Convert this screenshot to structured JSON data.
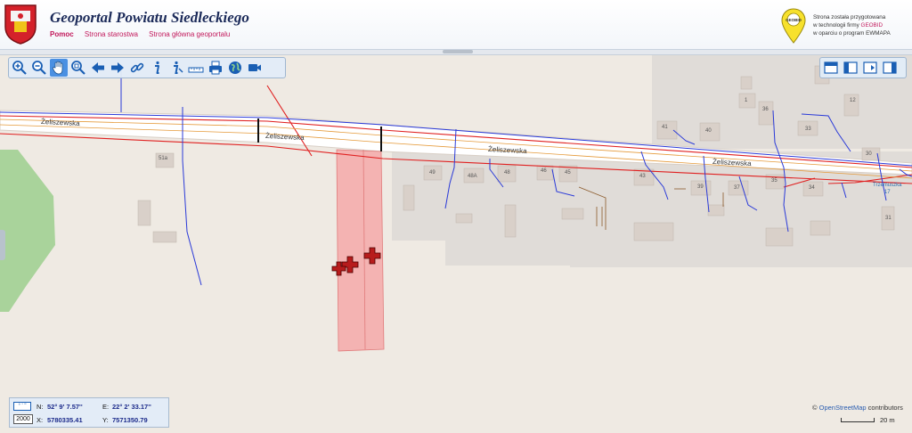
{
  "header": {
    "title": "Geoportal Powiatu Siedleckiego",
    "nav": [
      "Pomoc",
      "Strona starostwa",
      "Strona główna geoportalu"
    ],
    "logo_text": "GEOBID",
    "credit_line1": "Strona została przygotowana",
    "credit_line2_prefix": "w technologii firmy",
    "credit_line2_brand": "GEOBID",
    "credit_line3": "w oparciu o program EWMAPA"
  },
  "toolbar": {
    "tools": [
      {
        "name": "zoom-in-icon",
        "active": false
      },
      {
        "name": "zoom-out-icon",
        "active": false
      },
      {
        "name": "pan-hand-icon",
        "active": true
      },
      {
        "name": "zoom-box-icon",
        "active": false
      },
      {
        "name": "back-arrow-icon",
        "active": false
      },
      {
        "name": "forward-arrow-icon",
        "active": false
      },
      {
        "name": "link-icon",
        "active": false
      },
      {
        "name": "info-icon",
        "active": false
      },
      {
        "name": "info-select-icon",
        "active": false
      },
      {
        "name": "measure-icon",
        "active": false
      },
      {
        "name": "print-icon",
        "active": false
      },
      {
        "name": "globe-icon",
        "active": false
      },
      {
        "name": "video-icon",
        "active": false
      }
    ],
    "right_tools": [
      "panel-top-icon",
      "panel-left-icon",
      "panel-export-icon",
      "panel-right-icon"
    ]
  },
  "map": {
    "street_labels": [
      "Żeliszewska",
      "Żeliszewska",
      "Żeliszewska",
      "Żeliszewska"
    ],
    "house_numbers": [
      "51a",
      "49",
      "48A",
      "48",
      "46",
      "45",
      "43",
      "41",
      "40",
      "39",
      "37",
      "36",
      "35",
      "34",
      "33",
      "31",
      "30",
      "12",
      "1"
    ],
    "poi_label_line1": "Trzemuszka",
    "poi_label_line2": "17",
    "colors": {
      "road": "#ffffff",
      "building": "#d9d0c9",
      "parcel_highlight": "#f4a9a9",
      "green": "#a9d39b",
      "water_line": "#2a3ad8",
      "power_line": "#e02020"
    }
  },
  "coords": {
    "n_label": "N:",
    "n_value": "52° 9' 7.57''",
    "e_label": "E:",
    "e_value": "22° 2' 33.17''",
    "x_label": "X:",
    "x_value": "5780335.41",
    "y_label": "Y:",
    "y_value": "7571350.79",
    "system_label": "2000"
  },
  "attribution": {
    "symbol": "©",
    "link": "OpenStreetMap",
    "suffix": " contributors"
  },
  "scale": {
    "label": "20 m"
  }
}
